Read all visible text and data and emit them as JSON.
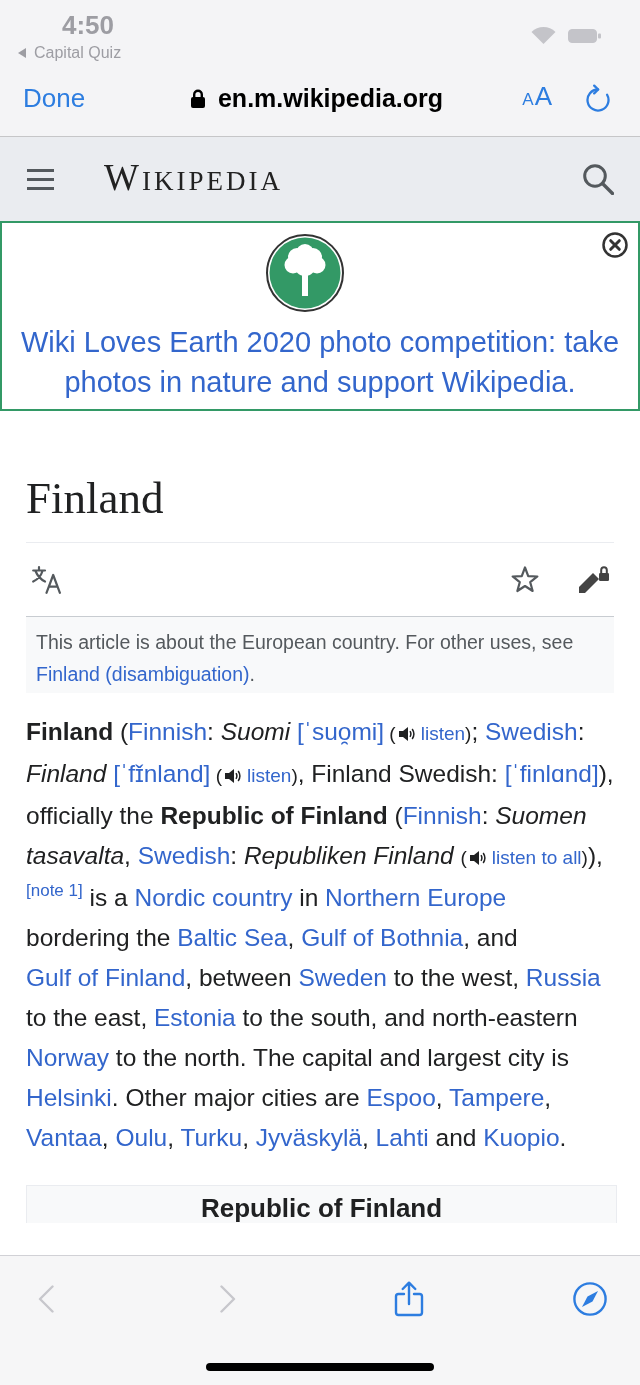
{
  "status_bar": {
    "time": "4:50",
    "back_app": "Capital Quiz"
  },
  "browser_bar": {
    "done": "Done",
    "url": "en.m.wikipedia.org",
    "text_size": {
      "small": "A",
      "large": "A"
    }
  },
  "site_header": {
    "logo": "WIKIPEDIA"
  },
  "banner": {
    "text": "Wiki Loves Earth 2020 photo competition: take photos in nature and support Wikipedia."
  },
  "article": {
    "title": "Finland",
    "watched": false,
    "hatnote": {
      "before": "This article is about the European country. For other uses, see ",
      "link": "Finland (disambiguation)",
      "after": "."
    },
    "paragraph": [
      {
        "kind": "text",
        "text": "**Finland** ("
      },
      {
        "kind": "link",
        "text": "Finnish"
      },
      {
        "kind": "text",
        "text": ": *Suomi* "
      },
      {
        "kind": "link",
        "text": "[ˈsuo̯mi]"
      },
      {
        "kind": "listen",
        "before": " (",
        "label": "listen",
        "after": ")"
      },
      {
        "kind": "text",
        "text": "; "
      },
      {
        "kind": "link",
        "text": "Swedish"
      },
      {
        "kind": "text",
        "text": ": *Finland* "
      },
      {
        "kind": "link",
        "text": "[ˈfɪ̌nland]"
      },
      {
        "kind": "listen",
        "before": " (",
        "label": "listen",
        "after": ")"
      },
      {
        "kind": "text",
        "text": ", Finland Swedish: "
      },
      {
        "kind": "link",
        "text": "[ˈfinlɑnd]"
      },
      {
        "kind": "text",
        "text": "), officially the **Republic of Finland** ("
      },
      {
        "kind": "link",
        "text": "Finnish"
      },
      {
        "kind": "text",
        "text": ": *Suomen tasavalta*, "
      },
      {
        "kind": "link",
        "text": "Swedish"
      },
      {
        "kind": "text",
        "text": ": *Republiken Finland* "
      },
      {
        "kind": "listen",
        "before": "(",
        "label": "listen to all",
        "after": ")"
      },
      {
        "kind": "text",
        "text": "),"
      },
      {
        "kind": "note",
        "text": "[note 1]"
      },
      {
        "kind": "text",
        "text": " is a "
      },
      {
        "kind": "link",
        "text": "Nordic country"
      },
      {
        "kind": "text",
        "text": " in "
      },
      {
        "kind": "link",
        "text": "Northern Europe"
      },
      {
        "kind": "text",
        "text": " bordering the "
      },
      {
        "kind": "link",
        "text": "Baltic Sea"
      },
      {
        "kind": "text",
        "text": ", "
      },
      {
        "kind": "link",
        "text": "Gulf of Bothnia"
      },
      {
        "kind": "text",
        "text": ", and "
      },
      {
        "kind": "link",
        "text": "Gulf of Finland"
      },
      {
        "kind": "text",
        "text": ", between "
      },
      {
        "kind": "link",
        "text": "Sweden"
      },
      {
        "kind": "text",
        "text": " to the west, "
      },
      {
        "kind": "link",
        "text": "Russia"
      },
      {
        "kind": "text",
        "text": " to the east, "
      },
      {
        "kind": "link",
        "text": "Estonia"
      },
      {
        "kind": "text",
        "text": " to the south, and north-eastern "
      },
      {
        "kind": "link",
        "text": "Norway"
      },
      {
        "kind": "text",
        "text": " to the north. The capital and largest city is "
      },
      {
        "kind": "link",
        "text": "Helsinki"
      },
      {
        "kind": "text",
        "text": ". Other major cities are "
      },
      {
        "kind": "link",
        "text": "Espoo"
      },
      {
        "kind": "text",
        "text": ", "
      },
      {
        "kind": "link",
        "text": "Tampere"
      },
      {
        "kind": "text",
        "text": ", "
      },
      {
        "kind": "link",
        "text": "Vantaa"
      },
      {
        "kind": "text",
        "text": ", "
      },
      {
        "kind": "link",
        "text": "Oulu"
      },
      {
        "kind": "text",
        "text": ", "
      },
      {
        "kind": "link",
        "text": "Turku"
      },
      {
        "kind": "text",
        "text": ", "
      },
      {
        "kind": "link",
        "text": "Jyväskylä"
      },
      {
        "kind": "text",
        "text": ", "
      },
      {
        "kind": "link",
        "text": "Lahti"
      },
      {
        "kind": "text",
        "text": " and "
      },
      {
        "kind": "link",
        "text": "Kuopio"
      },
      {
        "kind": "text",
        "text": "."
      }
    ],
    "infobox": {
      "title": "Republic of Finland"
    }
  },
  "toolbar": [
    {
      "kind": "back",
      "disabled": true
    },
    {
      "kind": "forward",
      "disabled": true
    },
    {
      "kind": "share",
      "disabled": false
    },
    {
      "kind": "compass",
      "disabled": false
    }
  ]
}
